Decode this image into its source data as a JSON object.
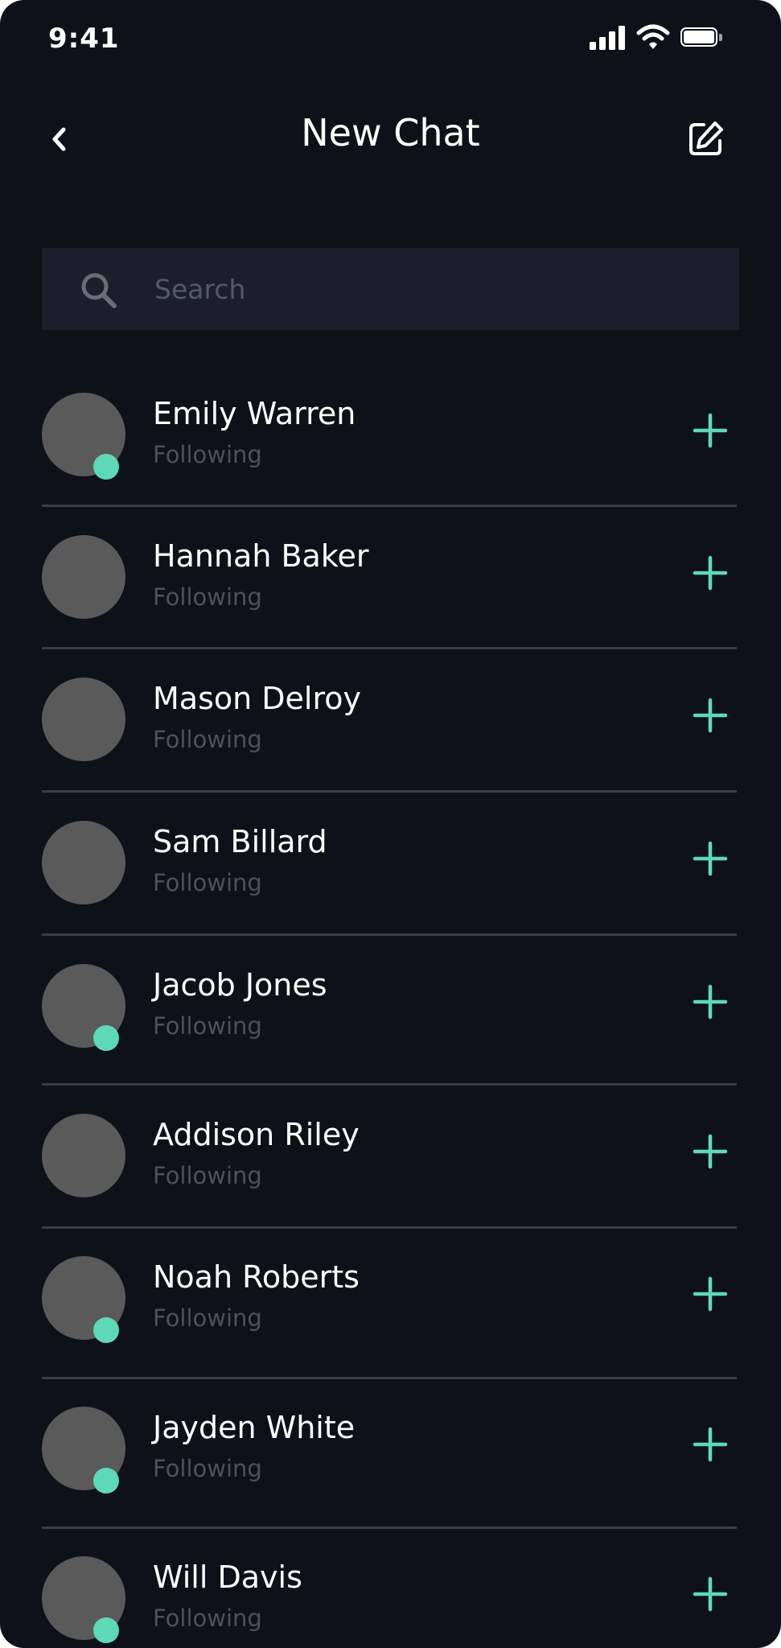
{
  "status_bar": {
    "time": "9:41"
  },
  "header": {
    "title": "New Chat",
    "back_icon": "chevron-left-icon",
    "compose_icon": "compose-icon"
  },
  "search": {
    "placeholder": "Search",
    "value": ""
  },
  "colors": {
    "background": "#0e1118",
    "search_background": "#1c1e2b",
    "accent": "#5ed9b7",
    "avatar": "#5a5a5a",
    "secondary_text": "#4e505a",
    "divider": "#3a3d46"
  },
  "contacts": [
    {
      "name": "Emily Warren",
      "status": "Following",
      "online": true
    },
    {
      "name": "Hannah Baker",
      "status": "Following",
      "online": false
    },
    {
      "name": "Mason Delroy",
      "status": "Following",
      "online": false
    },
    {
      "name": "Sam Billard",
      "status": "Following",
      "online": false
    },
    {
      "name": "Jacob Jones",
      "status": "Following",
      "online": true
    },
    {
      "name": "Addison Riley",
      "status": "Following",
      "online": false
    },
    {
      "name": "Noah Roberts",
      "status": "Following",
      "online": true
    },
    {
      "name": "Jayden White",
      "status": "Following",
      "online": true
    },
    {
      "name": "Will Davis",
      "status": "Following",
      "online": true
    }
  ]
}
